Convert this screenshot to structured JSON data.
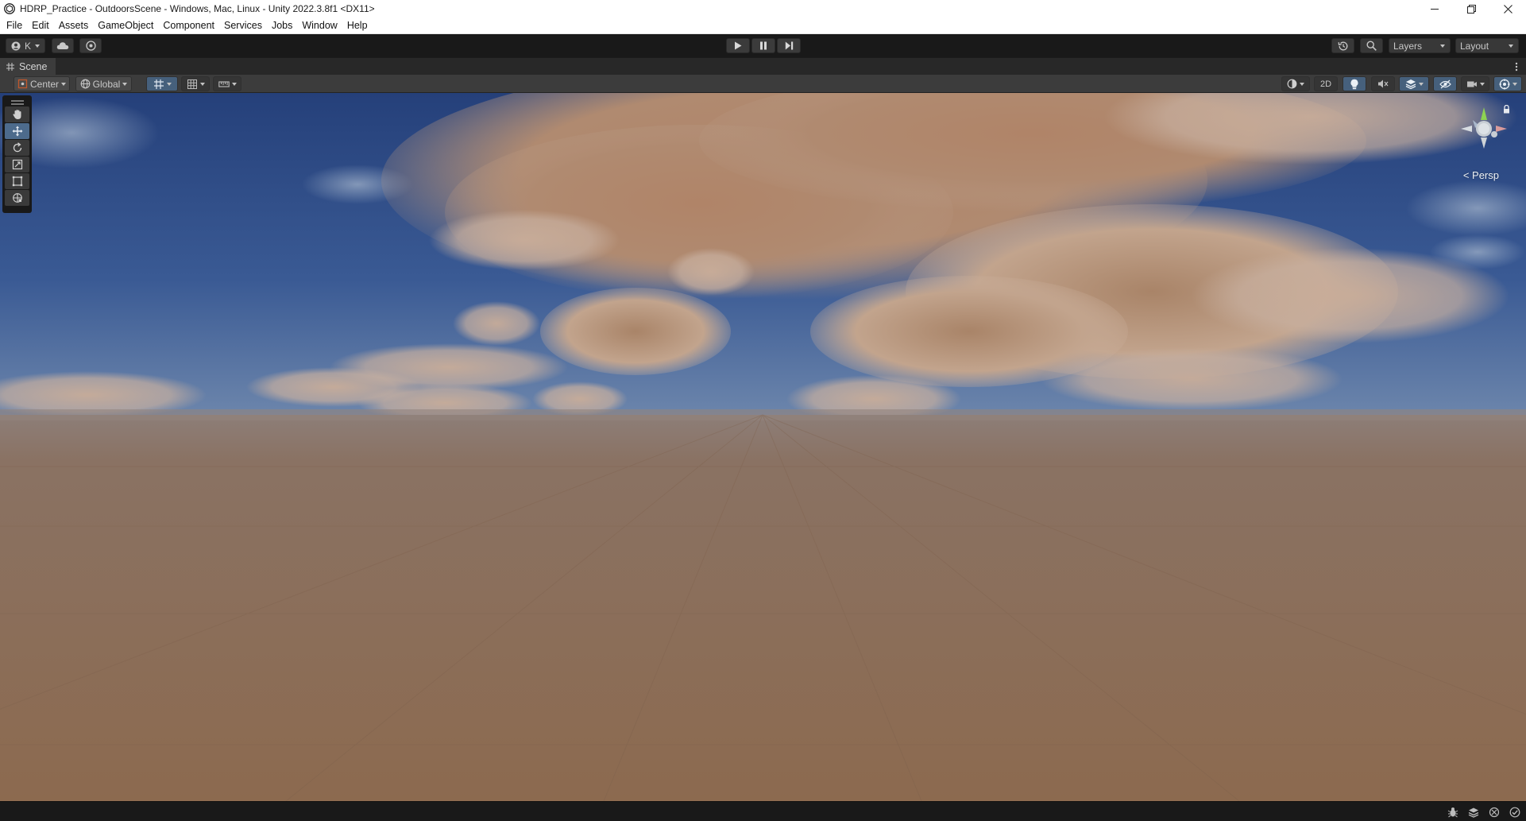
{
  "window": {
    "title": "HDRP_Practice - OutdoorsScene - Windows, Mac, Linux - Unity 2022.3.8f1 <DX11>"
  },
  "menu": {
    "items": [
      "File",
      "Edit",
      "Assets",
      "GameObject",
      "Component",
      "Services",
      "Jobs",
      "Window",
      "Help"
    ]
  },
  "toolbar": {
    "account_label": "K",
    "layers_label": "Layers",
    "layout_label": "Layout"
  },
  "scene": {
    "tab_label": "Scene",
    "pivot_label": "Center",
    "space_label": "Global",
    "mode_2d_label": "2D",
    "camera_label": "Persp"
  },
  "colors": {
    "sky_top": "#2a4a86",
    "sky_horizon": "#8a9db3",
    "ground": "#8c6a52",
    "cloud": "#b48c6e",
    "active_button": "#46607c",
    "window_bg": "#191919"
  },
  "icons": {
    "tools": [
      "hand-tool-icon",
      "move-tool-icon",
      "rotate-tool-icon",
      "scale-tool-icon",
      "rect-tool-icon",
      "transform-tool-icon"
    ],
    "status": [
      "bug-icon",
      "layers-icon",
      "debug-icon",
      "check-icon"
    ]
  }
}
